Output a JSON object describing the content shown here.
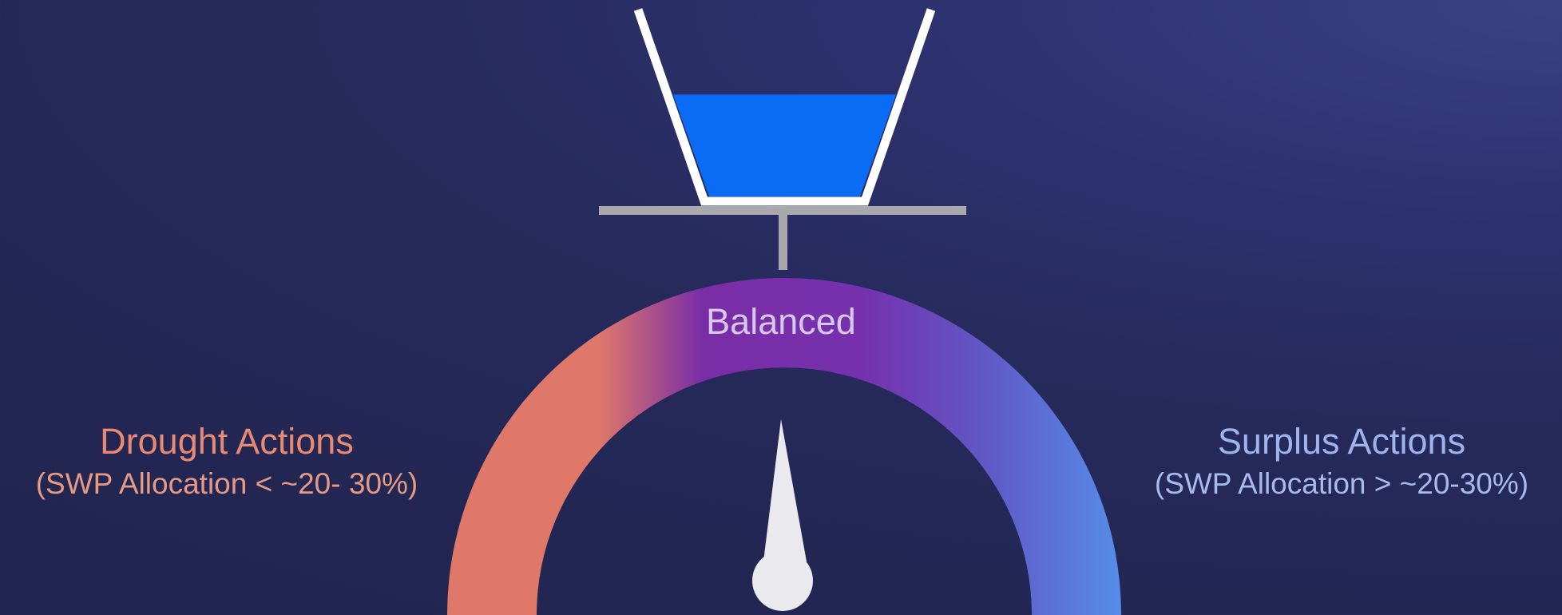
{
  "gauge": {
    "center_label": "Balanced",
    "needle_position": 0.5,
    "left": {
      "title": "Drought Actions",
      "subtitle": "(SWP Allocation < ~20- 30%)"
    },
    "right": {
      "title": "Surplus Actions",
      "subtitle": "(SWP Allocation > ~20-30%)"
    }
  },
  "vessel": {
    "fill_fraction": 0.55
  },
  "colors": {
    "drought": "#e0786a",
    "balanced": "#7a2ea6",
    "surplus": "#5592ec",
    "water": "#0a6cf5",
    "needle": "#e9e9ee",
    "stand": "#a9a9ad",
    "vessel_outline": "#ffffff"
  }
}
